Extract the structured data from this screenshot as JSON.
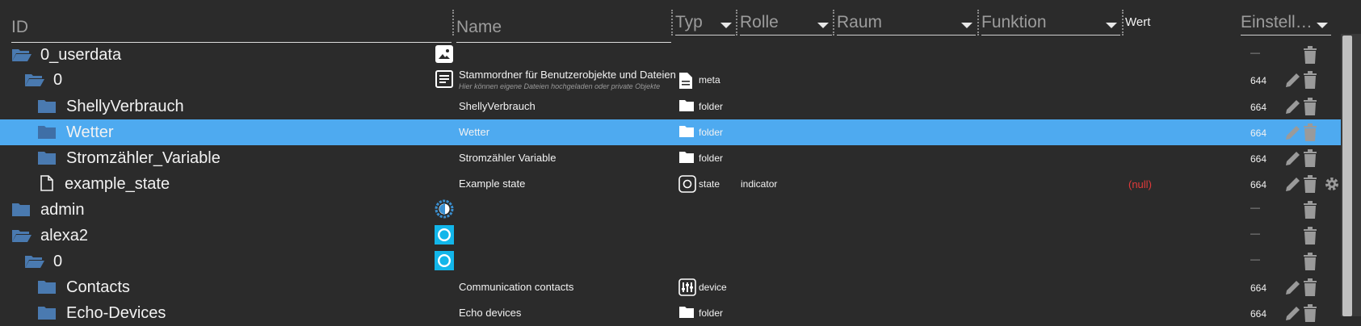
{
  "header": {
    "id_label": "ID",
    "name_label": "Name",
    "typ_label": "Typ",
    "rolle_label": "Rolle",
    "raum_label": "Raum",
    "funktion_label": "Funktion",
    "wert_label": "Wert",
    "settings_label": "Einstell…"
  },
  "rows": [
    {
      "id": "0_userdata",
      "name": "",
      "desc": "",
      "type": "",
      "role": "",
      "value": "",
      "perm": "—"
    },
    {
      "id": "0",
      "name": "Stammordner für Benutzerobjekte und Dateien",
      "desc": "Hier können eigene Dateien hochgeladen oder private Objekte",
      "type": "meta",
      "role": "",
      "value": "",
      "perm": "644"
    },
    {
      "id": "ShellyVerbrauch",
      "name": "ShellyVerbrauch",
      "desc": "",
      "type": "folder",
      "role": "",
      "value": "",
      "perm": "664"
    },
    {
      "id": "Wetter",
      "name": "Wetter",
      "desc": "",
      "type": "folder",
      "role": "",
      "value": "",
      "perm": "664"
    },
    {
      "id": "Stromzähler_Variable",
      "name": "Stromzähler Variable",
      "desc": "",
      "type": "folder",
      "role": "",
      "value": "",
      "perm": "664"
    },
    {
      "id": "example_state",
      "name": "Example state",
      "desc": "",
      "type": "state",
      "role": "indicator",
      "value": "(null)",
      "perm": "664"
    },
    {
      "id": "admin",
      "name": "",
      "desc": "",
      "type": "",
      "role": "",
      "value": "",
      "perm": "—"
    },
    {
      "id": "alexa2",
      "name": "",
      "desc": "",
      "type": "",
      "role": "",
      "value": "",
      "perm": "—"
    },
    {
      "id": "0",
      "name": "",
      "desc": "",
      "type": "",
      "role": "",
      "value": "",
      "perm": "—"
    },
    {
      "id": "Contacts",
      "name": "Communication contacts",
      "desc": "",
      "type": "device",
      "role": "",
      "value": "",
      "perm": "664"
    },
    {
      "id": "Echo-Devices",
      "name": "Echo devices",
      "desc": "",
      "type": "folder",
      "role": "",
      "value": "",
      "perm": "664"
    }
  ],
  "colors": {
    "background": "#2b2b2b",
    "selected_row": "#4eaaf0",
    "folder": "#4a7ab0",
    "null_value": "#e23a3a",
    "action_icon": "#9a9a9a"
  }
}
